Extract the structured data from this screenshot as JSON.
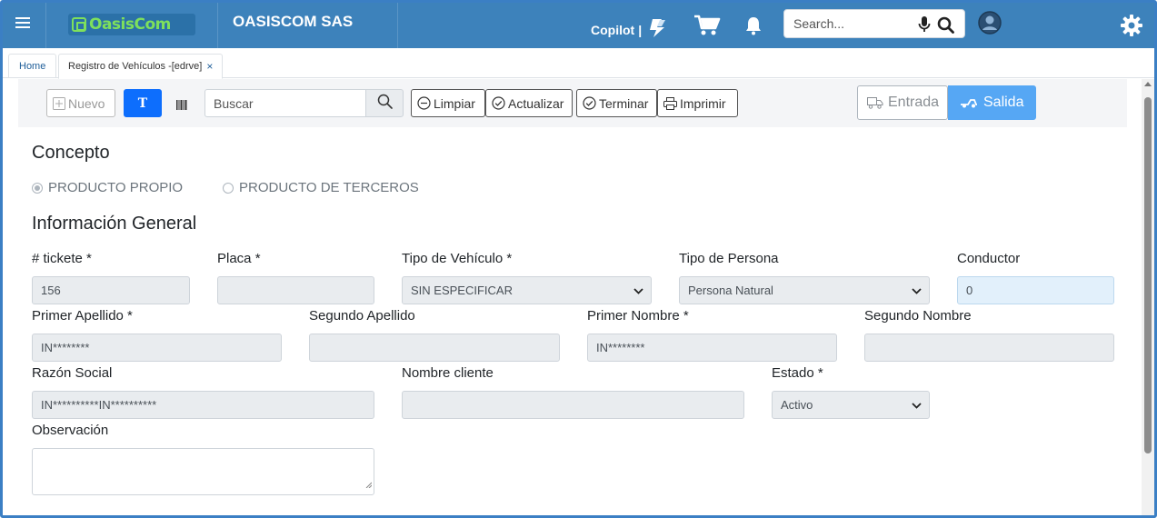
{
  "header": {
    "logo_text": "OasisCom",
    "company": "OASISCOM SAS",
    "copilot_label": "Copilot",
    "copilot_sep": "|",
    "search_placeholder": "Search...",
    "colors": {
      "bar": "#3d82bb",
      "logo": "#7ee05c"
    },
    "icons": [
      "menu-icon",
      "copilot-icon",
      "cart-icon",
      "bell-icon",
      "mic-icon",
      "search-icon",
      "user-icon",
      "gear-icon"
    ]
  },
  "tabs": {
    "home": "Home",
    "active": "Registro de Vehículos -[edrve]",
    "close": "×"
  },
  "toolbar": {
    "nuevo": "Nuevo",
    "t_toggle": "T",
    "buscar_placeholder": "Buscar",
    "limpiar": "Limpiar",
    "actualizar": "Actualizar",
    "terminar": "Terminar",
    "imprimir": "Imprimir",
    "entrada": "Entrada",
    "salida": "Salida",
    "colors": {
      "primary": "#0d6efd",
      "salida": "#56a7f4"
    }
  },
  "concepto": {
    "title": "Concepto",
    "options": [
      {
        "label": "PRODUCTO PROPIO",
        "checked": true
      },
      {
        "label": "PRODUCTO DE TERCEROS",
        "checked": false
      }
    ]
  },
  "info": {
    "title": "Información General",
    "ticket_label": "# tickete *",
    "ticket_value": "156",
    "placa_label": "Placa *",
    "placa_value": "",
    "tipo_vehiculo_label": "Tipo de Vehículo *",
    "tipo_vehiculo_value": "SIN ESPECIFICAR",
    "tipo_persona_label": "Tipo de Persona",
    "tipo_persona_value": "Persona Natural",
    "conductor_label": "Conductor",
    "conductor_value": "0",
    "primer_apellido_label": "Primer Apellido *",
    "primer_apellido_value": "IN********",
    "segundo_apellido_label": "Segundo Apellido",
    "segundo_apellido_value": "",
    "primer_nombre_label": "Primer Nombre *",
    "primer_nombre_value": "IN********",
    "segundo_nombre_label": "Segundo Nombre",
    "segundo_nombre_value": "",
    "razon_social_label": "Razón Social",
    "razon_social_value": "IN**********IN**********",
    "nombre_cliente_label": "Nombre cliente",
    "nombre_cliente_value": "",
    "estado_label": "Estado *",
    "estado_value": "Activo",
    "observacion_label": "Observación"
  }
}
